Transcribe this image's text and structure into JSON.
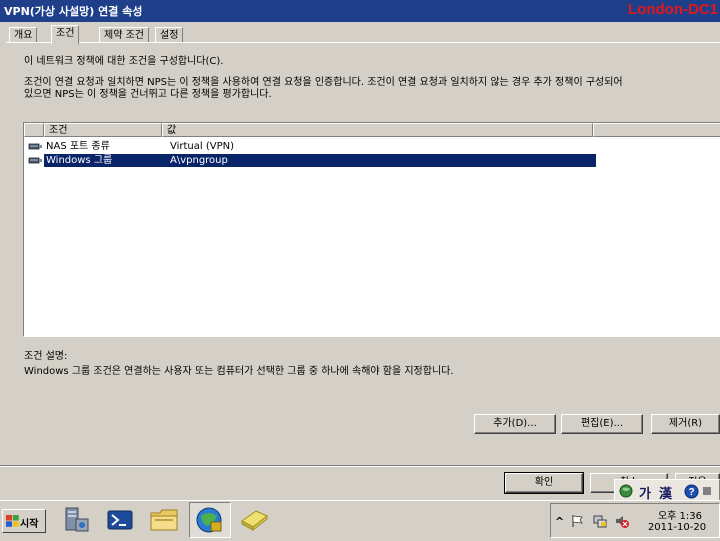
{
  "window": {
    "title": "VPN(가상 사설망) 연결 속성",
    "watermark": "London-DC1"
  },
  "tabs": [
    {
      "label": "개요",
      "active": false
    },
    {
      "label": "조건",
      "active": true
    },
    {
      "label": "제약 조건",
      "active": false
    },
    {
      "label": "설정",
      "active": false
    }
  ],
  "main": {
    "intro": "이 네트워크 정책에 대한 조건을 구성합니다(C).",
    "description_line1": "조건이 연결 요청과 일치하면 NPS는 이 정책을 사용하여 연결 요청을 인증합니다. 조건이 연결 요청과 일치하지 않는 경우 추가 정책이 구성되어",
    "description_line2": "있으면 NPS는 이 정책을 건너뛰고 다른 정책을 평가합니다."
  },
  "table": {
    "columns": [
      "조건",
      "값"
    ],
    "rows": [
      {
        "condition": "NAS 포트 종류",
        "value": "Virtual (VPN)",
        "selected": false,
        "icon": "network-cable-icon"
      },
      {
        "condition": "Windows 그룹",
        "value": "A\\vpngroup",
        "selected": true,
        "icon": "network-cable-icon"
      }
    ]
  },
  "condition_description": {
    "label": "조건 설명:",
    "text": "Windows 그룹 조건은 연결하는 사용자 또는 컴퓨터가 선택한 그룹 중 하나에 속해야 함을 지정합니다."
  },
  "buttons": {
    "add": "추가(D)...",
    "edit": "편집(E)...",
    "remove": "제거(R)",
    "ok": "확인",
    "cancel_partial": "취소",
    "apply_partial": "적용"
  },
  "langbar": {
    "ime_han": "가",
    "ime_hanja": "漢"
  },
  "taskbar": {
    "start_label": "시작",
    "clock_time": "오후 1:36",
    "clock_date": "2011-10-20",
    "tray_chevron": "^"
  }
}
